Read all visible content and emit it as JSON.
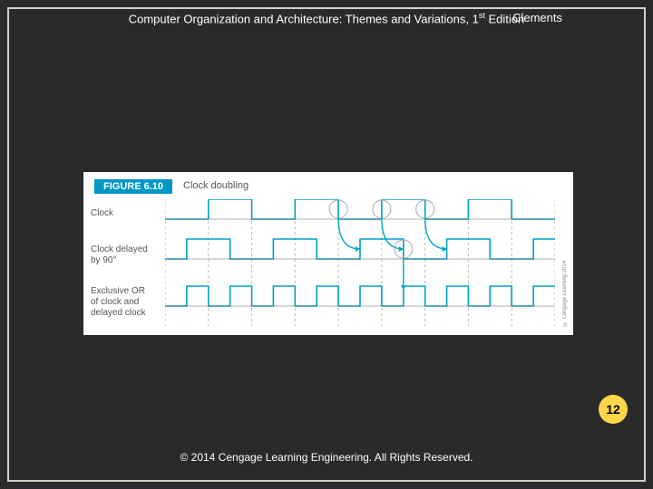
{
  "header": {
    "title_pre": "Computer Organization and Architecture: Themes and Variations, 1",
    "title_sup": "st",
    "title_post": " Edition",
    "author": "Clements"
  },
  "figure": {
    "badge": "FIGURE 6.10",
    "title": "Clock doubling",
    "signals": {
      "s1": "Clock",
      "s2_a": "Clock delayed",
      "s2_b": "by 90°",
      "s3_a": "Exclusive OR",
      "s3_b": "of clock and",
      "s3_c": "delayed clock"
    },
    "side_copy": "© Cengage Learning 2014"
  },
  "page_number": "12",
  "footer_copy": "© 2014 Cengage Learning Engineering. All Rights Reserved.",
  "chart_data": {
    "type": "line",
    "title": "Clock doubling",
    "series": [
      {
        "name": "Clock",
        "x": [
          0,
          1,
          1,
          2,
          2,
          3,
          3,
          4,
          4,
          5,
          5,
          6,
          6,
          7,
          7,
          8,
          8,
          9
        ],
        "values": [
          0,
          0,
          1,
          1,
          0,
          0,
          1,
          1,
          0,
          0,
          1,
          1,
          0,
          0,
          1,
          1,
          0,
          0
        ]
      },
      {
        "name": "Clock delayed by 90°",
        "x": [
          0,
          0.5,
          0.5,
          1.5,
          1.5,
          2.5,
          2.5,
          3.5,
          3.5,
          4.5,
          4.5,
          5.5,
          5.5,
          6.5,
          6.5,
          7.5,
          7.5,
          8.5,
          8.5,
          9
        ],
        "values": [
          0,
          0,
          1,
          1,
          0,
          0,
          1,
          1,
          0,
          0,
          1,
          1,
          0,
          0,
          1,
          1,
          0,
          0,
          1,
          1
        ]
      },
      {
        "name": "Exclusive OR of clock and delayed clock",
        "x": [
          0,
          0.5,
          0.5,
          1,
          1,
          1.5,
          1.5,
          2,
          2,
          2.5,
          2.5,
          3,
          3,
          3.5,
          3.5,
          4,
          4,
          4.5,
          4.5,
          5,
          5,
          5.5,
          5.5,
          6,
          6,
          6.5,
          6.5,
          7,
          7,
          7.5,
          7.5,
          8,
          8,
          8.5,
          8.5,
          9
        ],
        "values": [
          0,
          0,
          1,
          1,
          0,
          0,
          1,
          1,
          0,
          0,
          1,
          1,
          0,
          0,
          1,
          1,
          0,
          0,
          1,
          1,
          0,
          0,
          1,
          1,
          0,
          0,
          1,
          1,
          0,
          0,
          1,
          1,
          0,
          0,
          1,
          1
        ]
      }
    ],
    "xlabel": "",
    "ylabel": "",
    "xlim": [
      0,
      9
    ],
    "ylim": [
      0,
      1
    ]
  }
}
